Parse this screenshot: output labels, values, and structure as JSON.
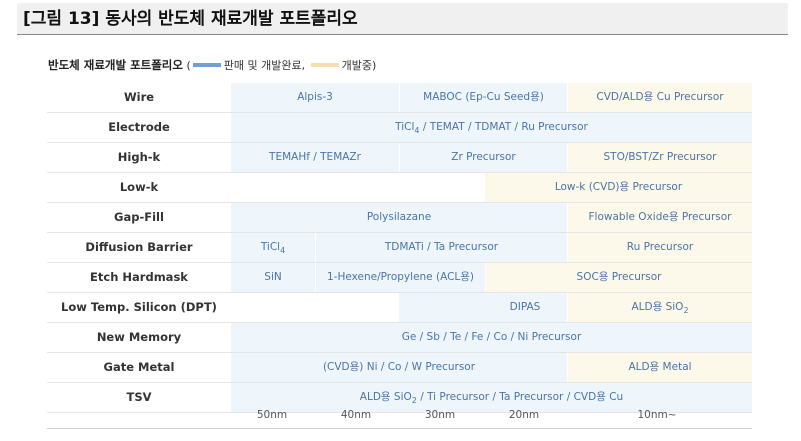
{
  "figure_title": "[그림 13] 동사의 반도체 재료개발 포트폴리오",
  "subtitle": {
    "title": "반도체 재료개발 포트폴리오",
    "open": " (",
    "legend_sold": "판매 및 개발완료,",
    "legend_dev": "개발중",
    "close": ")",
    "colors": {
      "sold": "#6f9fd8",
      "dev": "#f5deb0"
    }
  },
  "rows": [
    {
      "label": "Wire",
      "cells": [
        {
          "text": "Alpis-3",
          "status": "sold"
        },
        {
          "text": "MABOC (Ep-Cu Seed용)",
          "status": "sold"
        },
        {
          "text": "CVD/ALD용 Cu Precursor",
          "status": "dev"
        }
      ]
    },
    {
      "label": "Electrode",
      "cells": [
        {
          "text": "TiCl4 / TEMAT / TDMAT / Ru Precursor",
          "status": "sold"
        }
      ]
    },
    {
      "label": "High-k",
      "cells": [
        {
          "text": "TEMAHf / TEMAZr",
          "status": "sold"
        },
        {
          "text": "Zr Precursor",
          "status": "sold"
        },
        {
          "text": "STO/BST/Zr Precursor",
          "status": "dev"
        }
      ]
    },
    {
      "label": "Low-k",
      "cells": [
        {
          "text": "",
          "status": "none"
        },
        {
          "text": "Low-k (CVD)용 Precursor",
          "status": "dev"
        }
      ]
    },
    {
      "label": "Gap-Fill",
      "cells": [
        {
          "text": "Polysilazane",
          "status": "sold"
        },
        {
          "text": "Flowable Oxide용 Precursor",
          "status": "dev"
        }
      ]
    },
    {
      "label": "Diffusion Barrier",
      "cells": [
        {
          "text": "TiCl4",
          "status": "sold"
        },
        {
          "text": "TDMATi / Ta Precursor",
          "status": "sold"
        },
        {
          "text": "Ru Precursor",
          "status": "dev"
        }
      ]
    },
    {
      "label": "Etch Hardmask",
      "cells": [
        {
          "text": "SiN",
          "status": "sold"
        },
        {
          "text": "1-Hexene/Propylene (ACL용)",
          "status": "sold"
        },
        {
          "text": "SOC용 Precursor",
          "status": "dev"
        }
      ]
    },
    {
      "label": "Low Temp. Silicon (DPT)",
      "cells": [
        {
          "text": "",
          "status": "none"
        },
        {
          "text": "DIPAS",
          "status": "sold"
        },
        {
          "text": "ALD용 SiO2",
          "status": "dev"
        }
      ]
    },
    {
      "label": "New Memory",
      "cells": [
        {
          "text": "Ge / Sb / Te / Fe / Co / Ni Precursor",
          "status": "sold"
        }
      ]
    },
    {
      "label": "Gate Metal",
      "cells": [
        {
          "text": "(CVD용) Ni / Co / W Precursor",
          "status": "sold"
        },
        {
          "text": "ALD용 Metal",
          "status": "dev"
        }
      ]
    },
    {
      "label": "TSV",
      "cells": [
        {
          "text": "ALD용 SiO2 / Ti Precursor / Ta Precursor / CVD용 Cu",
          "status": "sold"
        }
      ]
    }
  ],
  "nodes": [
    "50nm",
    "40nm",
    "30nm",
    "20nm",
    "10nm~"
  ]
}
